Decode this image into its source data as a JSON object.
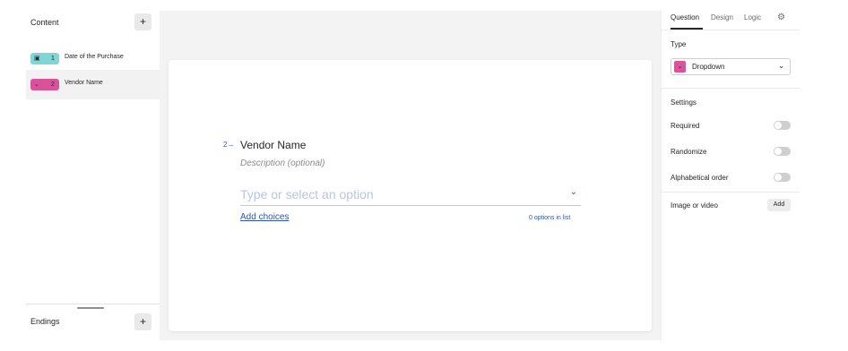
{
  "sidebar": {
    "title": "Content",
    "add_icon": "plus-icon",
    "add_label": "+",
    "items": [
      {
        "icon": "calendar-icon",
        "glyph": "▣",
        "number": "1",
        "label": "Date of the Purchase",
        "color": "#7fd6d6"
      },
      {
        "icon": "chevron-down-icon",
        "glyph": "⌄",
        "number": "2",
        "label": "Vendor Name",
        "color": "#d9539b"
      }
    ],
    "endings_title": "Endings",
    "endings_add_label": "+"
  },
  "question": {
    "number": "2→",
    "title": "Vendor Name",
    "description_placeholder": "Description (optional)",
    "input_placeholder": "Type or select an option",
    "add_choices_label": "Add choices",
    "options_count_text": "0 options in list",
    "accent_color": "#2f54b8"
  },
  "settings_panel": {
    "tabs": [
      "Question",
      "Design",
      "Logic"
    ],
    "active_tab": "Question",
    "type_label": "Type",
    "type_value": "Dropdown",
    "type_icon_glyph": "⌄",
    "settings_label": "Settings",
    "toggles": [
      {
        "label": "Required",
        "on": false
      },
      {
        "label": "Randomize",
        "on": false
      },
      {
        "label": "Alphabetical order",
        "on": false
      }
    ],
    "media_label": "Image or video",
    "media_add_label": "Add"
  }
}
